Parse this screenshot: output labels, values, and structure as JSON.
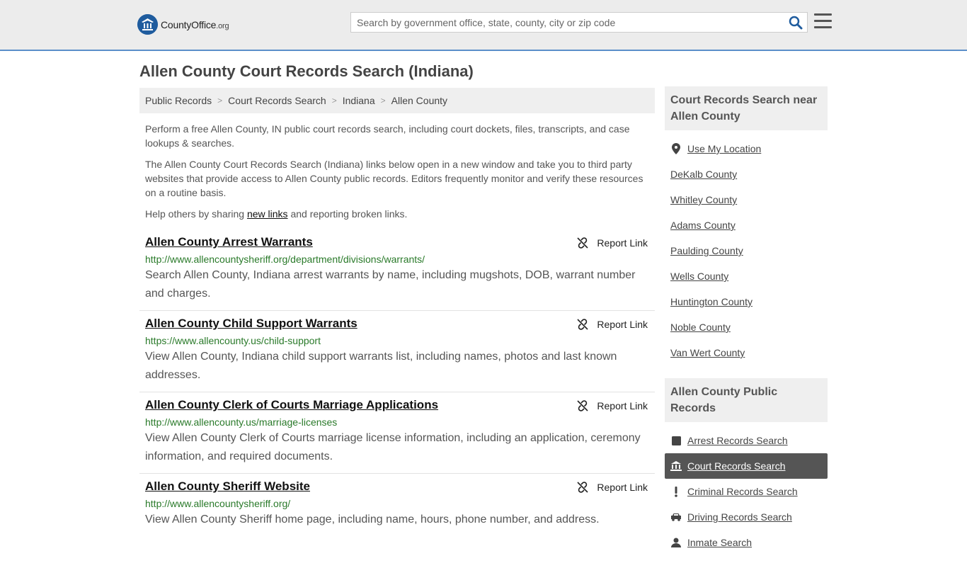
{
  "header": {
    "logo_main": "CountyOffice",
    "logo_suffix": ".org",
    "search_placeholder": "Search by government office, state, county, city or zip code"
  },
  "page_title": "Allen County Court Records Search (Indiana)",
  "breadcrumb": [
    "Public Records",
    "Court Records Search",
    "Indiana",
    "Allen County"
  ],
  "intro": {
    "p1": "Perform a free Allen County, IN public court records search, including court dockets, files, transcripts, and case lookups & searches.",
    "p2": "The Allen County Court Records Search (Indiana) links below open in a new window and take you to third party websites that provide access to Allen County public records. Editors frequently monitor and verify these resources on a routine basis.",
    "p3_before": "Help others by sharing ",
    "p3_link": "new links",
    "p3_after": " and reporting broken links."
  },
  "report_label": "Report Link",
  "entries": [
    {
      "title": "Allen County Arrest Warrants",
      "url": "http://www.allencountysheriff.org/department/divisions/warrants/",
      "desc": "Search Allen County, Indiana arrest warrants by name, including mugshots, DOB, warrant number and charges."
    },
    {
      "title": "Allen County Child Support Warrants",
      "url": "https://www.allencounty.us/child-support",
      "desc": "View Allen County, Indiana child support warrants list, including names, photos and last known addresses."
    },
    {
      "title": "Allen County Clerk of Courts Marriage Applications",
      "url": "http://www.allencounty.us/marriage-licenses",
      "desc": "View Allen County Clerk of Courts marriage license information, including an application, ceremony information, and required documents."
    },
    {
      "title": "Allen County Sheriff Website",
      "url": "http://www.allencountysheriff.org/",
      "desc": "View Allen County Sheriff home page, including name, hours, phone number, and address."
    }
  ],
  "sidebar": {
    "near_heading": "Court Records Search near Allen County",
    "use_location": "Use My Location",
    "near_items": [
      "DeKalb County",
      "Whitley County",
      "Adams County",
      "Paulding County",
      "Wells County",
      "Huntington County",
      "Noble County",
      "Van Wert County"
    ],
    "public_heading": "Allen County Public Records",
    "public_items": [
      {
        "label": "Arrest Records Search",
        "icon": "square-icon"
      },
      {
        "label": "Court Records Search",
        "icon": "courthouse-icon"
      },
      {
        "label": "Criminal Records Search",
        "icon": "exclamation-icon"
      },
      {
        "label": "Driving Records Search",
        "icon": "car-icon"
      },
      {
        "label": "Inmate Search",
        "icon": "inmate-icon"
      }
    ]
  },
  "colors": {
    "brand_blue": "#1f5c9e",
    "url_green": "#2a7a2a",
    "active_bg": "#555555"
  }
}
